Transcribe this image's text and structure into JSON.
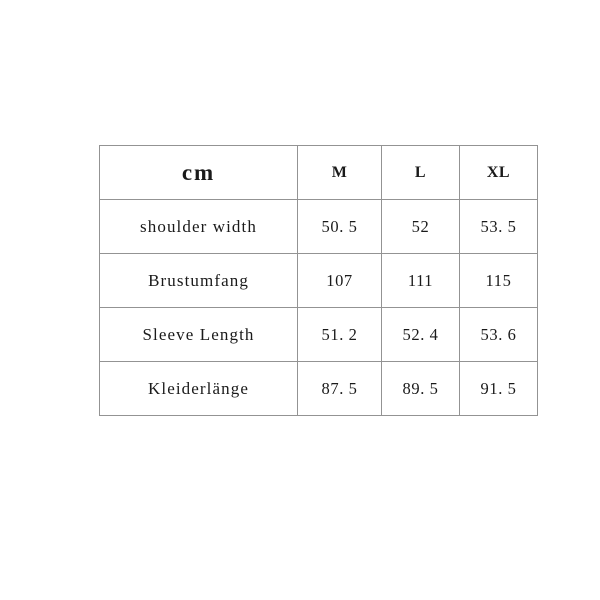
{
  "table": {
    "unit_header": "cm",
    "size_headers": [
      "M",
      "L",
      "XL"
    ],
    "rows": [
      {
        "label": "shoulder width",
        "values": [
          "50. 5",
          "52",
          "53. 5"
        ]
      },
      {
        "label": "Brustumfang",
        "values": [
          "107",
          "111",
          "115"
        ]
      },
      {
        "label": "Sleeve Length",
        "values": [
          "51. 2",
          "52. 4",
          "53. 6"
        ]
      },
      {
        "label": "Kleiderlänge",
        "values": [
          "87. 5",
          "89. 5",
          "91. 5"
        ]
      }
    ]
  },
  "colors": {
    "background": "#ffffff",
    "border": "#939393",
    "text": "#1a1a1a"
  }
}
